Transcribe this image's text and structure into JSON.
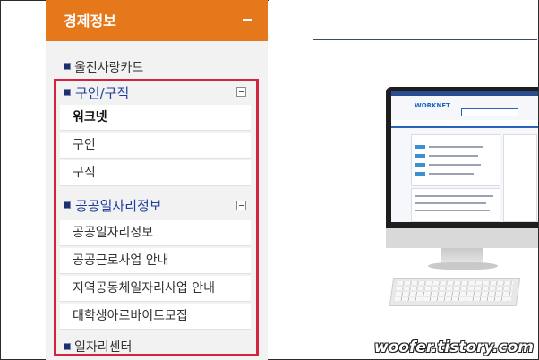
{
  "sidebar": {
    "title": "경제정보",
    "top_item": "울진사랑카드",
    "sections": [
      {
        "title": "구인/구직",
        "items": [
          "워크넷",
          "구인",
          "구직"
        ]
      },
      {
        "title": "공공일자리정보",
        "items": [
          "공공일자리정보",
          "공공근로사업 안내",
          "지역공동체일자리사업 안내",
          "대학생아르바이트모집"
        ]
      }
    ],
    "bottom_item": "일자리센터"
  },
  "monitor": {
    "site_logo": "WORKNET"
  },
  "watermark": "woofer.tistory.com",
  "colors": {
    "header": "#e5781a",
    "highlight_border": "#d32340",
    "section_title": "#1f3fa0",
    "bullet": "#1c2f6e"
  }
}
